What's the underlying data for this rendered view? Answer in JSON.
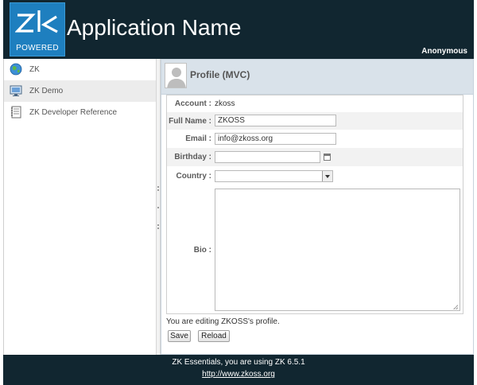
{
  "header": {
    "logo_caption": "POWERED",
    "app_title": "Application Name",
    "user": "Anonymous"
  },
  "sidebar": {
    "items": [
      {
        "label": "ZK",
        "icon": "globe-icon",
        "active": false
      },
      {
        "label": "ZK Demo",
        "icon": "monitor-icon",
        "active": true
      },
      {
        "label": "ZK Developer Reference",
        "icon": "document-icon",
        "active": false
      }
    ]
  },
  "profile": {
    "title": "Profile (MVC)",
    "labels": {
      "account": "Account :",
      "full_name": "Full Name :",
      "email": "Email :",
      "birthday": "Birthday :",
      "country": "Country :",
      "bio": "Bio :"
    },
    "values": {
      "account": "zkoss",
      "full_name": "ZKOSS",
      "email": "info@zkoss.org",
      "birthday": "",
      "country": "",
      "bio": ""
    },
    "message": "You are editing ZKOSS's profile.",
    "save_label": "Save",
    "reload_label": "Reload"
  },
  "footer": {
    "text": "ZK Essentials, you are using ZK 6.5.1",
    "link": "http://www.zkoss.org"
  },
  "colors": {
    "header_bg": "#112630",
    "logo_bg": "#1e7fbf",
    "panel_header_bg": "#d9e2ea"
  }
}
